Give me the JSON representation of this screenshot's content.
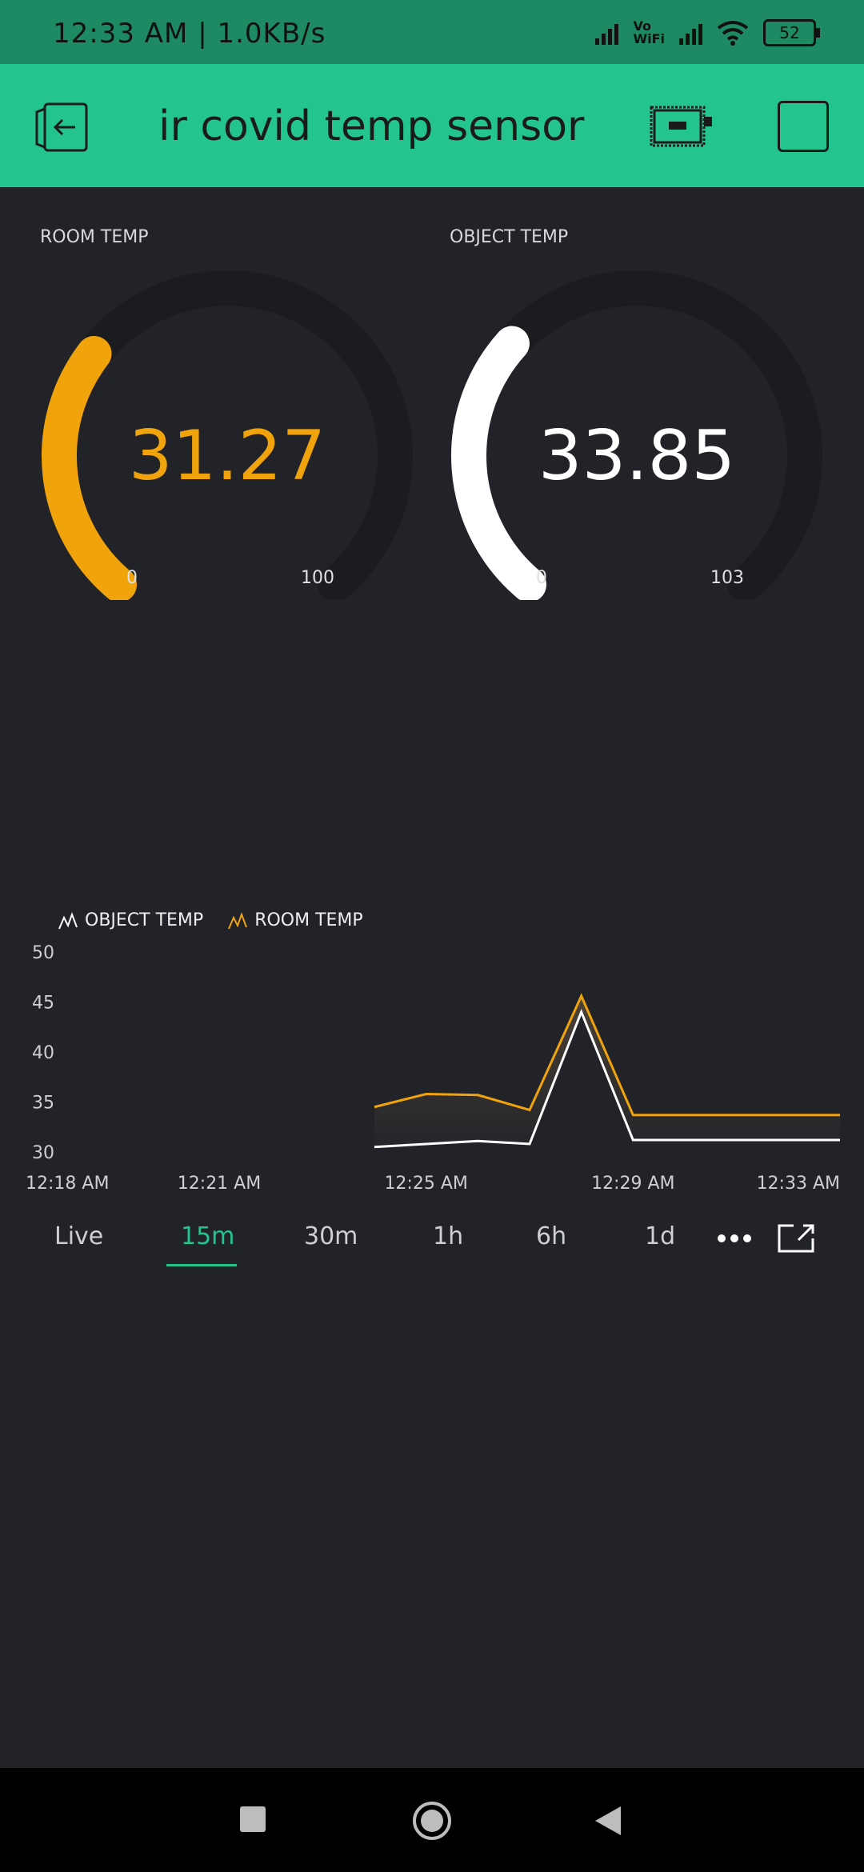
{
  "status": {
    "time_net": "12:33 AM | 1.0KB/s",
    "vowifi": "Vo\nWiFi",
    "battery": "52"
  },
  "app": {
    "title": "ir covid temp sensor"
  },
  "gauges": [
    {
      "label": "ROOM TEMP",
      "value": "31.27",
      "min": "0",
      "max": "100",
      "color": "#f0a30a",
      "fraction": 0.3127
    },
    {
      "label": "OBJECT TEMP",
      "value": "33.85",
      "min": "0",
      "max": "103",
      "color": "#ffffff",
      "fraction": 0.3286
    }
  ],
  "chart_data": {
    "type": "line",
    "legend": [
      "OBJECT TEMP",
      "ROOM TEMP"
    ],
    "ylim": [
      30,
      50
    ],
    "yticks": [
      "50",
      "45",
      "40",
      "35",
      "30"
    ],
    "xticks": [
      "12:18 AM",
      "12:21 AM",
      "12:25 AM",
      "12:29 AM",
      "12:33 AM"
    ],
    "series": [
      {
        "name": "OBJECT TEMP",
        "color": "#ffffff",
        "points": [
          {
            "t": "12:24 AM",
            "y": 30.5
          },
          {
            "t": "12:25 AM",
            "y": 30.8
          },
          {
            "t": "12:26 AM",
            "y": 31.1
          },
          {
            "t": "12:27 AM",
            "y": 30.8
          },
          {
            "t": "12:28 AM",
            "y": 44.0
          },
          {
            "t": "12:29 AM",
            "y": 31.2
          },
          {
            "t": "12:33 AM",
            "y": 31.2
          }
        ]
      },
      {
        "name": "ROOM TEMP",
        "color": "#f0a30a",
        "points": [
          {
            "t": "12:24 AM",
            "y": 34.5
          },
          {
            "t": "12:25 AM",
            "y": 35.8
          },
          {
            "t": "12:26 AM",
            "y": 35.7
          },
          {
            "t": "12:27 AM",
            "y": 34.2
          },
          {
            "t": "12:28 AM",
            "y": 45.6
          },
          {
            "t": "12:29 AM",
            "y": 33.7
          },
          {
            "t": "12:33 AM",
            "y": 33.7
          }
        ]
      }
    ]
  },
  "tabs": [
    "Live",
    "15m",
    "30m",
    "1h",
    "6h",
    "1d"
  ],
  "active_tab": "15m",
  "icons": {
    "back": "exit-door-icon",
    "device": "device-board-icon",
    "more": "more-dots-icon",
    "expand": "open-external-icon"
  }
}
